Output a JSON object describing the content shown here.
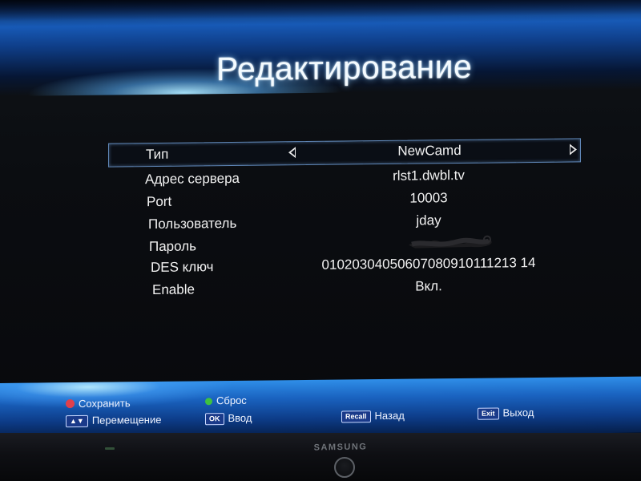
{
  "title": "Редактирование",
  "fields": [
    {
      "label": "Тип",
      "value": "NewCamd"
    },
    {
      "label": "Адрес сервера",
      "value": "rlst1.dwbl.tv"
    },
    {
      "label": "Port",
      "value": "10003"
    },
    {
      "label": "Пользователь",
      "value": "jday"
    },
    {
      "label": "Пароль",
      "value": ""
    },
    {
      "label": "DES ключ",
      "value": "01020304050607080910111213 14"
    },
    {
      "label": "Enable",
      "value": "Вкл."
    }
  ],
  "hints": {
    "save": "Сохранить",
    "reset": "Сброс",
    "move": "Перемещение",
    "move_key": "▲▼",
    "ok_key": "OK",
    "ok": "Ввод",
    "recall_key": "Recall",
    "back": "Назад",
    "exit_key": "Exit",
    "exit": "Выход"
  },
  "bezel": {
    "brand": "SAMSUNG"
  },
  "colors": {
    "save_dot": "#e0404c",
    "reset_dot": "#3fc23f",
    "accent_band": "#1a63c0",
    "selection_border": "#5f86b6"
  },
  "icons": {
    "type_prev": "triangle-left-icon",
    "type_next": "triangle-right-icon",
    "power": "power-button-icon"
  }
}
